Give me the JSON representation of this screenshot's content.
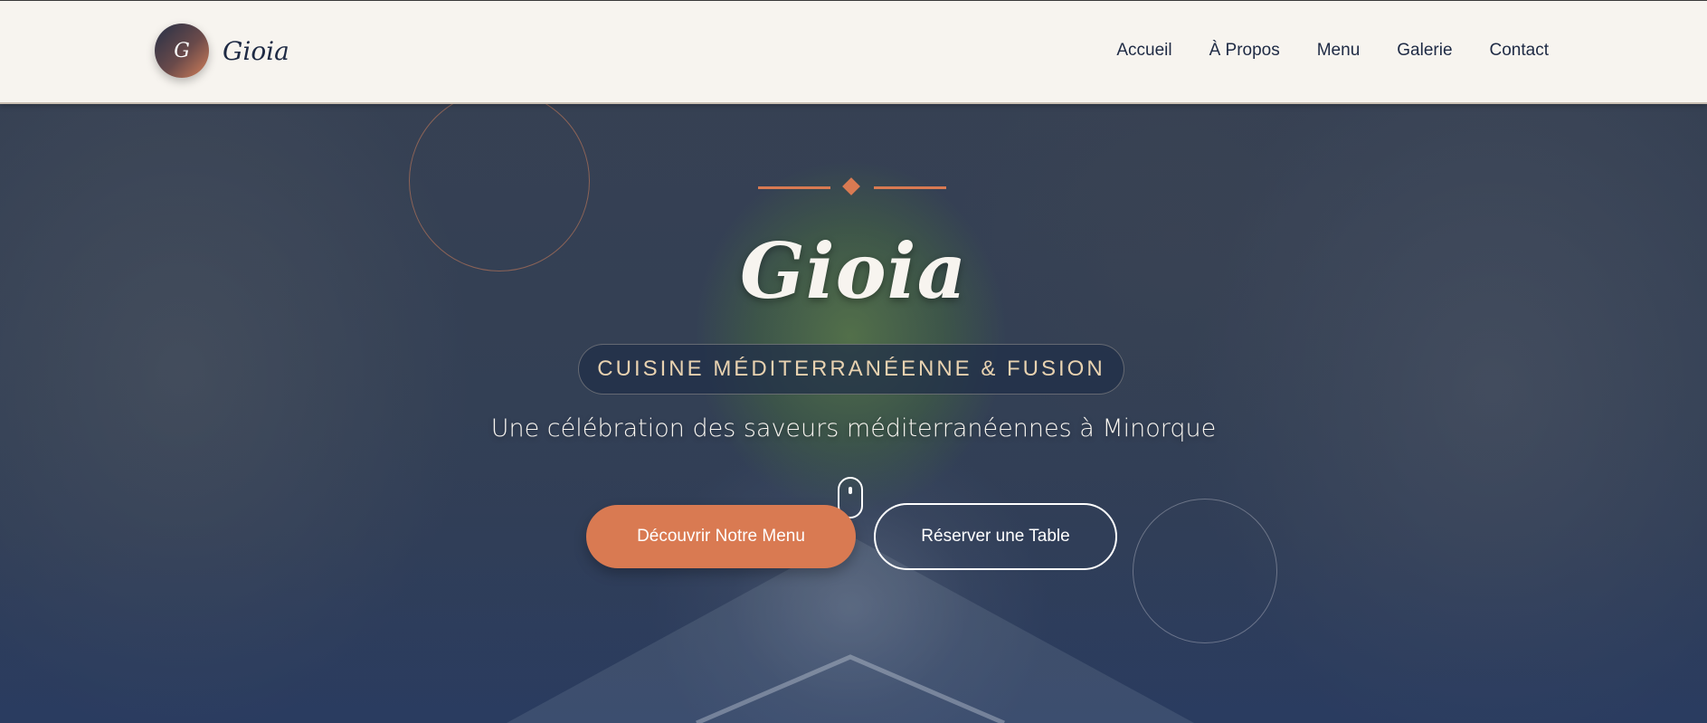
{
  "brand": {
    "logo_letter": "G",
    "name": "Gioia"
  },
  "nav": {
    "items": [
      {
        "label": "Accueil"
      },
      {
        "label": "À Propos"
      },
      {
        "label": "Menu"
      },
      {
        "label": "Galerie"
      },
      {
        "label": "Contact"
      }
    ]
  },
  "hero": {
    "title": "Gioia",
    "tagline": "CUISINE MÉDITERRANÉENNE & FUSION",
    "subtitle": "Une célébration des saveurs méditerranéennes à Minorque",
    "primary_button": "Découvrir Notre Menu",
    "secondary_button": "Réserver une Table"
  },
  "colors": {
    "accent": "#d97a52",
    "navy": "#1e2a44",
    "nav_background": "#f7f4ef",
    "tagline_text": "#e8d2b0"
  },
  "icons": {
    "scroll_indicator": "mouse-scroll-icon",
    "divider_ornament": "diamond-icon"
  }
}
